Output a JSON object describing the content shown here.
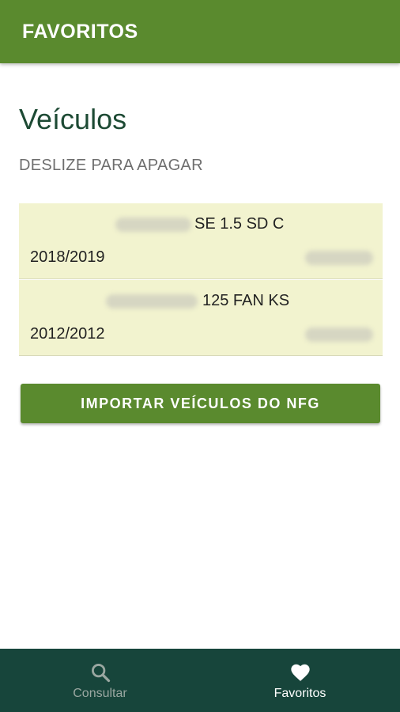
{
  "topbar": {
    "title": "FAVORITOS"
  },
  "section": {
    "title": "Veículos",
    "hint": "DESLIZE PARA APAGAR"
  },
  "vehicles": [
    {
      "model": "SE 1.5 SD C",
      "years": "2018/2019"
    },
    {
      "model": "125 FAN KS",
      "years": "2012/2012"
    }
  ],
  "import_button": {
    "label": "IMPORTAR VEÍCULOS DO NFG"
  },
  "bottom_nav": {
    "items": [
      {
        "label": "Consultar",
        "icon": "search-icon",
        "active": false
      },
      {
        "label": "Favoritos",
        "icon": "heart-icon",
        "active": true
      }
    ]
  },
  "colors": {
    "primary": "#5a8a2e",
    "nav_background": "#17453b",
    "row_background": "#f2f3cf",
    "title": "#1d4a34"
  }
}
